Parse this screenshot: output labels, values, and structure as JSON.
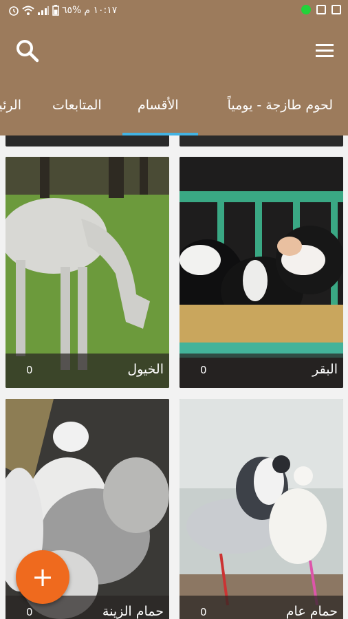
{
  "status_bar": {
    "time": "١٠:١٧ م",
    "battery": "%٦٥",
    "icons": [
      "notification-dot-icon",
      "gallery-icon",
      "screenshot-icon",
      "alarm-icon",
      "wifi-icon",
      "signal-icon",
      "battery-icon"
    ]
  },
  "app_bar": {
    "icons": [
      "search-icon",
      "hamburger-menu-icon"
    ],
    "color": "#9c7b5c"
  },
  "tabs": {
    "items": [
      {
        "label": "لحوم طازجة - يومياً"
      },
      {
        "label": "الأقسام"
      },
      {
        "label": "المتابعات"
      },
      {
        "label": "الرئيسية"
      }
    ],
    "active": "الأقسام",
    "indicator_color": "#43b3e3"
  },
  "categories": [
    {
      "title": "البقر",
      "count": "0",
      "image": "cows-photo"
    },
    {
      "title": "الخيول",
      "count": "0",
      "image": "horse-photo"
    },
    {
      "title": "حمام عام",
      "count": "0",
      "image": "pigeons-photo"
    },
    {
      "title": "حمام الزينة",
      "count": "0",
      "image": "fancy-pigeons-photo"
    }
  ],
  "fab": {
    "label": "+",
    "color": "#ef6a1e"
  }
}
